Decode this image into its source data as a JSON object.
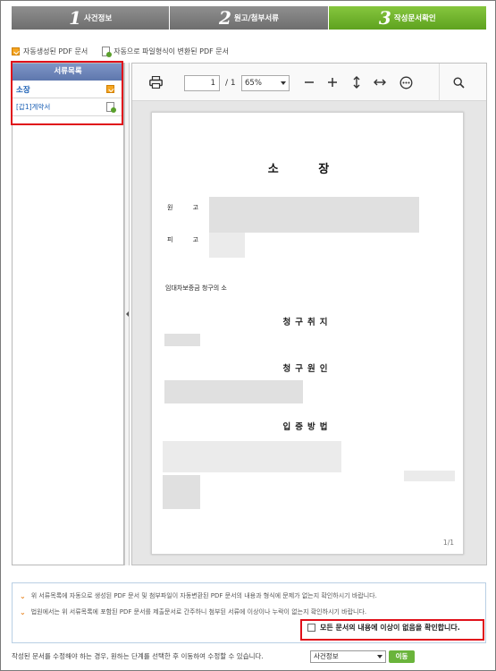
{
  "steps": [
    {
      "num": "1",
      "label": "사건정보"
    },
    {
      "num": "2",
      "label": "원고/첨부서류"
    },
    {
      "num": "3",
      "label": "작성문서확인"
    }
  ],
  "legend": {
    "auto_pdf": "자동생성된 PDF 문서",
    "converted_pdf": "자동으로 파일형식이 변환된 PDF 문서"
  },
  "doc_list": {
    "header": "서류목록",
    "items": [
      {
        "label": "소장",
        "icon": "orange-check-icon"
      },
      {
        "label": "[갑1]계약서",
        "icon": "converted-doc-icon"
      }
    ]
  },
  "viewer": {
    "page_current": "1",
    "page_total": "/ 1",
    "zoom": "65%"
  },
  "document": {
    "title": "소 장",
    "plaintiff_label": "원 고",
    "defendant_label": "피 고",
    "case_name": "임대차보증금 청구의 소",
    "sections": [
      "청구취지",
      "청구원인",
      "입증방법"
    ],
    "page_number": "1/1"
  },
  "notice": {
    "line1": "위 서류목록에 자동으로 생성된 PDF 문서 및 첨부파일이 자동변환된 PDF 문서의 내용과 형식에 문제가 없는지 확인하시기 바랍니다.",
    "line2": "법원에서는 위 서류목록에 포함된 PDF 문서를 제출문서로 간주하니 첨부된 서류에 이상이나 누락이 없는지 확인하시기 바랍니다.",
    "confirm_label": "모든 문서의 내용에 이상이 없음을 확인합니다."
  },
  "bottom": {
    "text": "작성된 문서를 수정해야 하는 경우, 원하는 단계를 선택한 후 이동하여 수정할 수 있습니다.",
    "select_value": "사건정보",
    "go_button": "이동"
  },
  "colors": {
    "step_active": "#6bb22f",
    "step_inactive": "#7d7d7d",
    "highlight": "#e0101a",
    "header_blue": "#6a82b8"
  }
}
